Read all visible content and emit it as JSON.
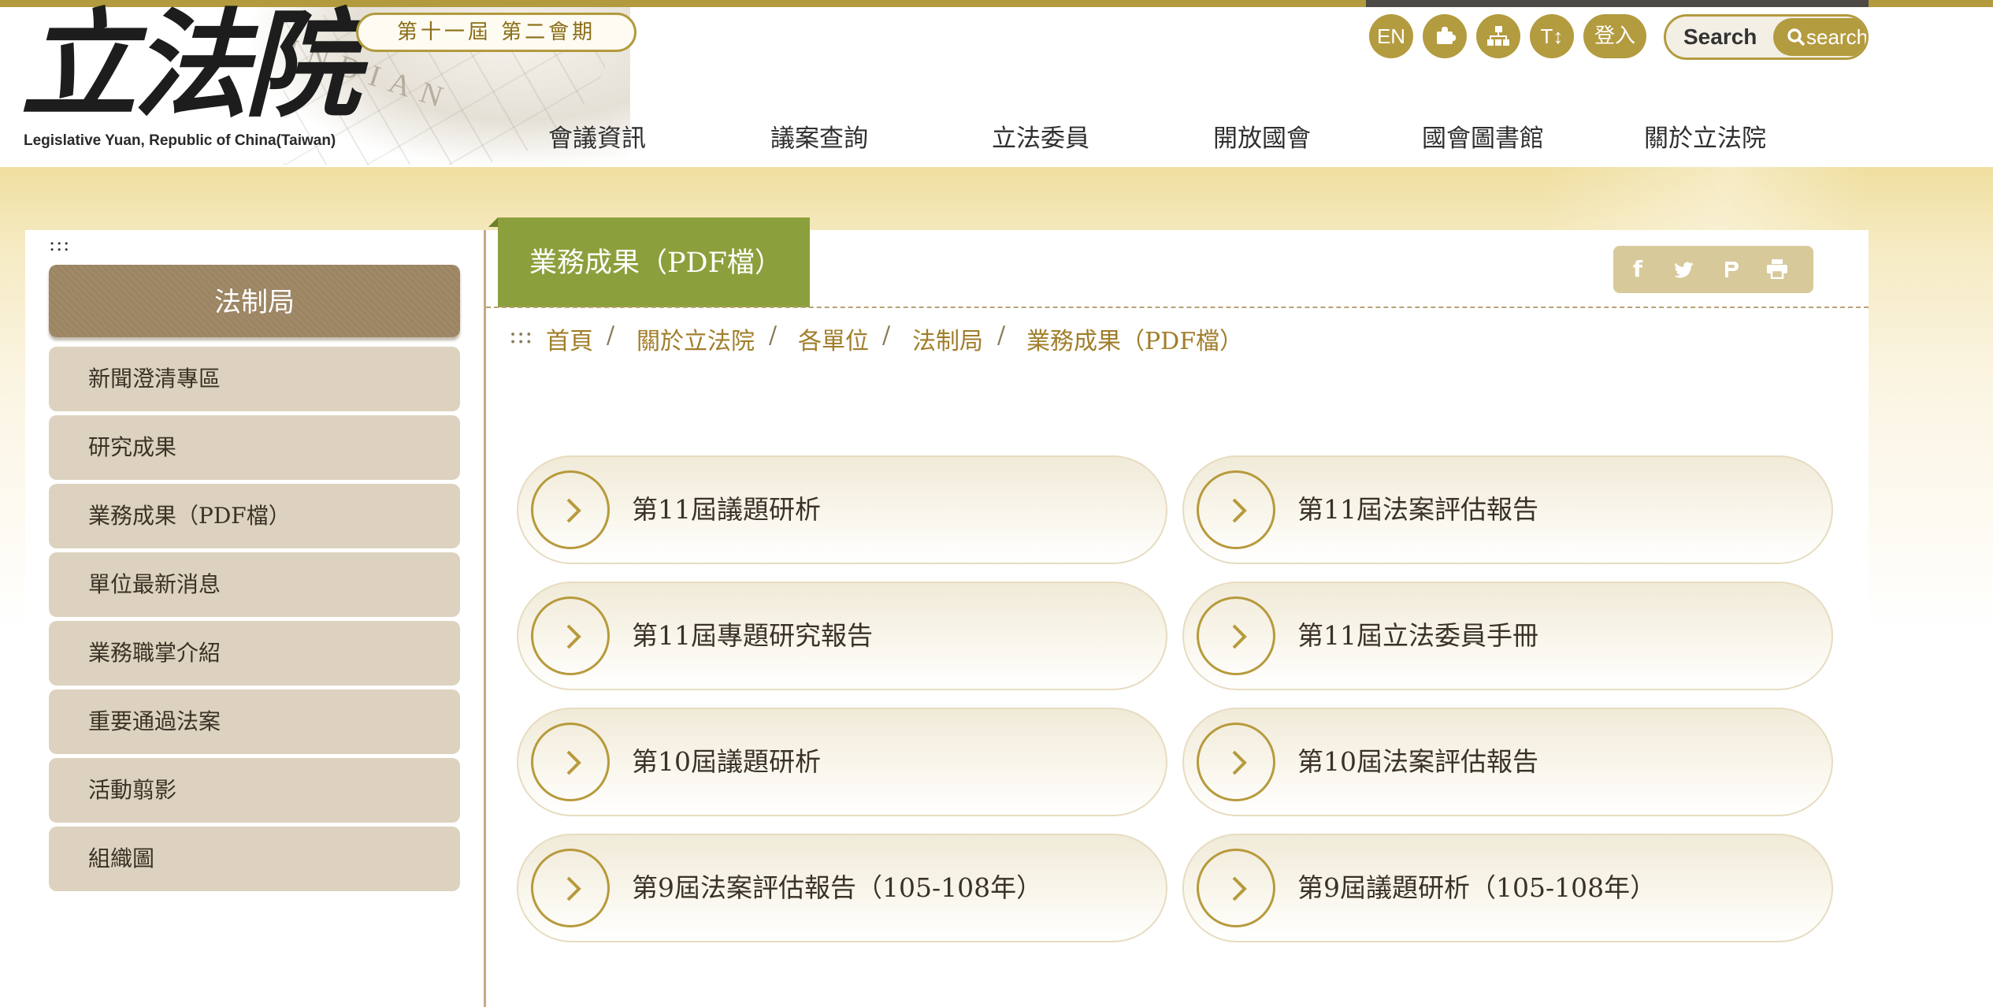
{
  "header": {
    "logo_text": "立法院",
    "logo_subtitle": "Legislative Yuan, Republic of China(Taiwan)",
    "session_badge": "第十一屆 第二會期",
    "utility": {
      "en_label": "EN",
      "plugin_icon": "puzzle-icon",
      "sitemap_icon": "sitemap-icon",
      "fontsize_label": "T↕",
      "login_label": "登入"
    },
    "search": {
      "placeholder": "Search",
      "button_label": "search"
    },
    "nav": [
      "會議資訊",
      "議案查詢",
      "立法委員",
      "開放國會",
      "國會圖書館",
      "關於立法院"
    ]
  },
  "sidebar": {
    "access_key": ":::",
    "title": "法制局",
    "items": [
      "新聞澄清專區",
      "研究成果",
      "業務成果（PDF檔）",
      "單位最新消息",
      "業務職掌介紹",
      "重要通過法案",
      "活動翦影",
      "組織圖"
    ]
  },
  "main": {
    "title": "業務成果（PDF檔）",
    "share_icons": [
      "facebook-icon",
      "twitter-icon",
      "plurk-icon",
      "print-icon",
      "back-icon"
    ],
    "breadcrumb": {
      "access_key": ":::",
      "items": [
        "首頁",
        "關於立法院",
        "各單位",
        "法制局",
        "業務成果（PDF檔）"
      ],
      "separator": "/"
    },
    "links": [
      "第11屆議題研析",
      "第11屆法案評估報告",
      "第11屆專題研究報告",
      "第11屆立法委員手冊",
      "第10屆議題研析",
      "第10屆法案評估報告",
      "第9屆法案評估報告（105-108年）",
      "第9屆議題研析（105-108年）"
    ]
  },
  "colors": {
    "gold": "#b39b3f",
    "title_green": "#8ba03c",
    "sidebar_item_bg": "#ddd2bf",
    "breadcrumb": "#a07e2a"
  }
}
